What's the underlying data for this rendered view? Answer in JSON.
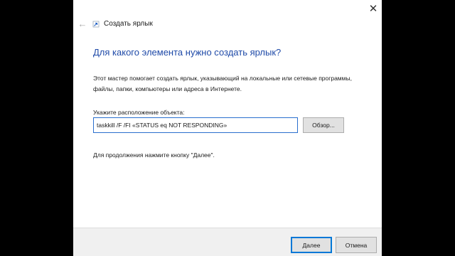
{
  "window": {
    "close_glyph": "✕",
    "back_glyph": "←"
  },
  "wizard": {
    "title": "Создать ярлык",
    "heading": "Для какого элемента нужно создать ярлык?",
    "description_lines": [
      "Этот мастер помогает создать ярлык, указывающий на локальные или сетевые программы,",
      "файлы, папки, компьютеры или адреса в Интернете."
    ],
    "location_label": "Укажите расположение объекта:",
    "location_value": "taskkill /F /FI «STATUS eq NOT RESPONDING»",
    "browse_label": "Обзор...",
    "hint": "Для продолжения нажмите кнопку \"Далее\"."
  },
  "footer": {
    "next_label": "Далее",
    "cancel_label": "Отмена"
  },
  "colors": {
    "heading": "#1f4aa8",
    "input_focus_border": "#2a6fce",
    "default_button_border": "#0078d7",
    "backdrop": "#000000"
  }
}
